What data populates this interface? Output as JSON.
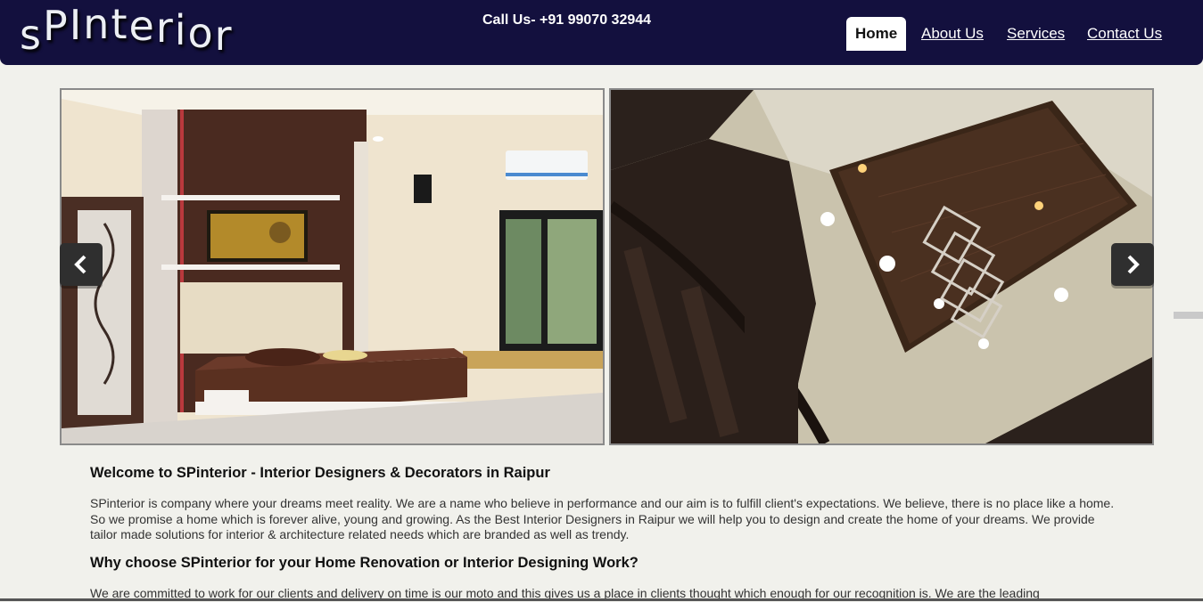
{
  "header": {
    "logo_text": "sPInterior",
    "phone": "Call Us- +91 99070 32944",
    "nav": [
      {
        "label": "Home",
        "active": true
      },
      {
        "label": "About Us",
        "active": false
      },
      {
        "label": "Services",
        "active": false
      },
      {
        "label": "Contact Us",
        "active": false
      }
    ]
  },
  "slider": {
    "prev_icon": "chevron-left-icon",
    "next_icon": "chevron-right-icon"
  },
  "content": {
    "heading1": "Welcome to SPinterior - Interior Designers & Decorators in Raipur",
    "paragraph1": "SPinterior is company where your dreams meet reality. We are a name who believe in performance and our aim is to fulfill client's expectations. We believe, there is no place like a home. So we promise a home which is forever alive, young and growing. As the Best Interior Designers in Raipur we will help you to design and create the home of your dreams. We provide tailor made solutions for interior & architecture related needs which are branded as well as trendy.",
    "heading2": "Why choose SPinterior for your Home Renovation or Interior Designing Work?",
    "paragraph2": "We are committed to work for our clients and delivery on time is our moto and this gives us a place in clients thought which enough for our recognition is. We are the leading"
  },
  "colors": {
    "header_bg": "#13103e",
    "page_bg": "#f1f1ec"
  }
}
